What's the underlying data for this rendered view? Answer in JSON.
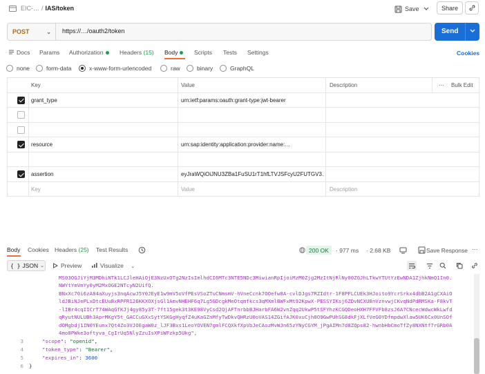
{
  "header": {
    "workspace": "EIC-…",
    "separator": "/",
    "request_name": "IAS/token",
    "save_label": "Save",
    "share_label": "Share"
  },
  "request": {
    "method": "POST",
    "url": "https://…/oauth2/token",
    "send_label": "Send"
  },
  "tabs": [
    {
      "label": "Docs"
    },
    {
      "label": "Params"
    },
    {
      "label": "Authorization"
    },
    {
      "label": "Headers",
      "count": "(15)"
    },
    {
      "label": "Body"
    },
    {
      "label": "Scripts"
    },
    {
      "label": "Tests"
    },
    {
      "label": "Settings"
    }
  ],
  "cookies_label": "Cookies",
  "body_types": [
    "none",
    "form-data",
    "x-www-form-urlencoded",
    "raw",
    "binary",
    "GraphQL"
  ],
  "body_type_selected": "x-www-form-urlencoded",
  "table": {
    "headers": {
      "key": "Key",
      "value": "Value",
      "description": "Description",
      "bulk_edit": "Bulk Edit"
    },
    "rows": [
      {
        "checked": true,
        "key": "grant_type",
        "value": "urn:ietf:params:oauth:grant-type:jwt-bearer",
        "description": ""
      },
      {
        "checked": false,
        "key": "",
        "value": "",
        "description": ""
      },
      {
        "checked": false,
        "key": "",
        "value": "",
        "description": ""
      },
      {
        "checked": true,
        "key": "resource",
        "value": "urn:sap:identity:application:provider:name:…",
        "description": ""
      },
      {
        "checked": false,
        "key": "",
        "value": "",
        "description": ""
      },
      {
        "checked": true,
        "key": "assertion",
        "value": "eyJraWQiOiJNU3ZBa1FuSU1rT1hfLTVJSFcyU2FUTGV3…",
        "description": ""
      }
    ],
    "placeholder": {
      "key": "Key",
      "value": "Value",
      "description": "Description"
    }
  },
  "response": {
    "tabs": [
      {
        "label": "Body"
      },
      {
        "label": "Cookies"
      },
      {
        "label": "Headers",
        "count": "(25)"
      },
      {
        "label": "Test Results"
      }
    ],
    "status": "200 OK",
    "time": "977 ms",
    "size": "2.68 KB",
    "save_response_label": "Save Response",
    "format": "JSON",
    "preview_label": "Preview",
    "visualize_label": "Visualize"
  },
  "code": {
    "token_lines": [
      "MS03OGJiYjM3MDhiNTk1LCJleHAiOjE3NzUxOTg2NzIsImlhdCI6MTc3NTE5NDc3MiwianRpIjoiMzM0Zjg2MzItNjRlNy00ZGJhLTkwYTUtYzEwNDA1ZjhkNmQ1In0.",
      "NWYtYmVmYy0yM2MxOGE2NTcyN2UifQ.",
      "BNxXc70i6zA84aXuyjs3nqAcwJ5Y0JEyE1w9mV5oVfPEsVSoZTuCNmsmV-hVneCcnk7OOefw8A-cvlDJgs7RZIdtr-1F8PFLCUEk3HJoito9YcrSrkx4dbB2A1gCXAiO",
      "ldJBiNJePLxDtcEUuBxRPFR126KKXOXjsGl1AmvNHEHF6q7Lg5GDcgkMeOtqmfkcs3qMXmlBWFxMt92KpwX-PESSYIKsj6ZDvNCXU8nVznvwjCKvqNdPdRMSKa-F8kvT",
      "-lIBr4cqIICrT74WAqGfKJj4gy85y3T-7ft15gek3t3KE98VyCsd2QjAFTnrbbBJHarbFA6W2vnZqq2UkwP5tSFYhzKCGQDeoHXH7FFVFb8zsJ6A7CNcecWdwcWkLwfd",
      "qRyutNULUBh3AprMKgY5t_GACCuGXxSytYSKGgHyqfZ4uKaGZnMfyTwDkvQHRzU0oVAS14ZGifAJK0xuCjh8O9GwPUhSG8dkFjXLfVeG0YDfmpdwXlaw5UK6Cx0UnSOf",
      "dOMgbdj1IN0YEunx7Qt4Zo3VJOEgaW0z_lJF3Bxs1LeoYOVEN7gmlFCQXkfXpVbJeCAozMvWJn65zYNyCGYM_jPgAIMn7d8ZQps82-hwnbHbCmoTfZy8NXNtf7rGRb0A",
      "4mo8PWke3oftyva_CgIrUq5NlyZzuIsXPiWFzkp5Ukg\","
    ],
    "lines": [
      {
        "num": "3",
        "key": "\"scope\"",
        "value": "\"openid\"",
        "type": "string"
      },
      {
        "num": "4",
        "key": "\"token_type\"",
        "value": "\"Bearer\"",
        "type": "string"
      },
      {
        "num": "5",
        "key": "\"expires_in\"",
        "value": "3600",
        "type": "number"
      },
      {
        "num": "6",
        "key": "}",
        "value": "",
        "type": "brace"
      }
    ]
  }
}
